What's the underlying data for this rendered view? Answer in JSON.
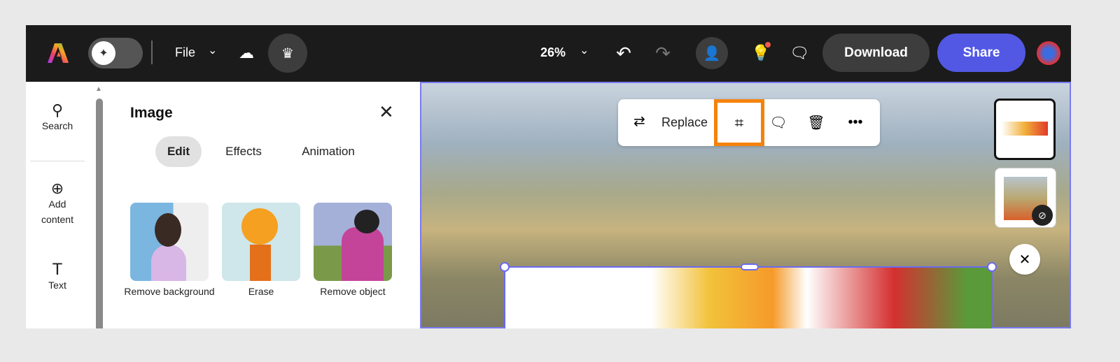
{
  "header": {
    "file_label": "File",
    "zoom": "26%",
    "download": "Download",
    "share": "Share"
  },
  "rail": [
    {
      "label": "Search"
    },
    {
      "label": "Add content"
    },
    {
      "label": "Text"
    }
  ],
  "panel": {
    "title": "Image",
    "tabs": [
      "Edit",
      "Effects",
      "Animation"
    ],
    "tools": [
      {
        "label": "Remove background"
      },
      {
        "label": "Erase"
      },
      {
        "label": "Remove object"
      }
    ]
  },
  "toolbar": {
    "replace": "Replace"
  },
  "colors": {
    "accent": "#5258e4",
    "crop_highlight": "#f5820d",
    "header": "#1b1b1b"
  }
}
